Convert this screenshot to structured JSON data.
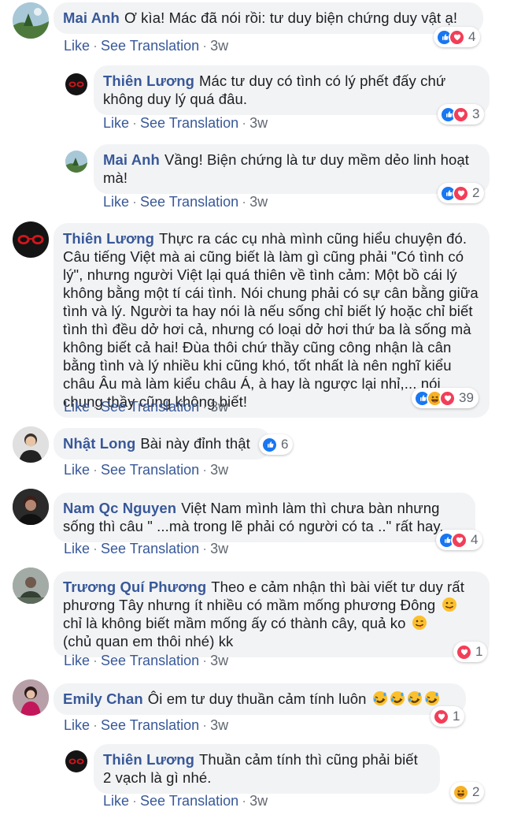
{
  "actions": {
    "like": "Like",
    "see_translation": "See Translation",
    "separator": "·"
  },
  "comments": [
    {
      "author": "Mai Anh",
      "text": "Ơ kìa! Mác đã nói rồi: tư duy biện chứng duy vật ạ!",
      "time": "3w",
      "reaction_count": "4",
      "reaction_types": [
        "like",
        "love"
      ]
    },
    {
      "author": "Thiên Lương",
      "text": "Mác tư duy có tình có lý phết đấy chứ không duy lý quá đâu.",
      "time": "3w",
      "reaction_count": "3",
      "reaction_types": [
        "like",
        "love"
      ]
    },
    {
      "author": "Mai Anh",
      "text": "Vầng! Biện chứng là tư duy mềm dẻo linh hoạt mà!",
      "time": "3w",
      "reaction_count": "2",
      "reaction_types": [
        "like",
        "love"
      ]
    },
    {
      "author": "Thiên Lương",
      "text": "Thực ra các cụ nhà mình cũng hiểu chuyện đó. Câu tiếng Việt mà ai cũng biết là làm gì cũng phải \"Có tình có lý\", nhưng người Việt lại quá thiên về tình cảm: Một bồ cái lý không bằng một tí cái tình. Nói chung phải có sự cân bằng giữa tình và lý. Người ta hay nói là nếu sống chỉ biết lý hoặc chỉ biết tình thì đều dở hơi cả, nhưng có loại dở hơi thứ ba là sống mà không biết cả hai! Đùa thôi chứ thầy cũng công nhận là cân bằng tình và lý nhiều khi cũng khó, tốt nhất là nên nghĩ kiểu châu Âu mà làm kiểu châu Á, à hay là ngược lại nhỉ,... nói chung thầy cũng không biết!",
      "time": "3w",
      "reaction_count": "39",
      "reaction_types": [
        "like",
        "haha",
        "love"
      ]
    },
    {
      "author": "Nhật Long",
      "text": "Bài này đỉnh thật",
      "time": "3w",
      "reaction_count": "6",
      "reaction_types": [
        "like"
      ]
    },
    {
      "author": "Nam Qc Nguyen",
      "text": "Việt Nam mình làm thì chưa bàn nhưng sống thì câu \" ...mà trong lẽ phải có người có ta ..\" rất hay.",
      "time": "3w",
      "reaction_count": "4",
      "reaction_types": [
        "like",
        "love"
      ]
    },
    {
      "author": "Trương Quí Phương",
      "text": "Theo e cảm nhận thì bài viết tư duy rất phương Tây nhưng ít nhiều có mầm mống phương Đông",
      "text2": "chỉ là không biết mầm mống ấy có thành cây, quả ko",
      "text3": "(chủ quan em thôi nhé) kk",
      "time": "3w",
      "reaction_count": "1",
      "reaction_types": [
        "love"
      ]
    },
    {
      "author": "Emily Chan",
      "text": "Ôi em tư duy thuần cảm tính luôn",
      "time": "3w",
      "reaction_count": "1",
      "reaction_types": [
        "love"
      ]
    },
    {
      "author": "Thiên Lương",
      "text": "Thuần cảm tính thì cũng phải biết 2 vạch là gì nhé.",
      "time": "3w",
      "reaction_count": "2",
      "reaction_types": [
        "haha"
      ]
    }
  ],
  "colors": {
    "author": "#385898",
    "bubble": "#f2f3f5",
    "like": "#1877f2",
    "love": "#f33e58",
    "haha": "#f7b125"
  }
}
